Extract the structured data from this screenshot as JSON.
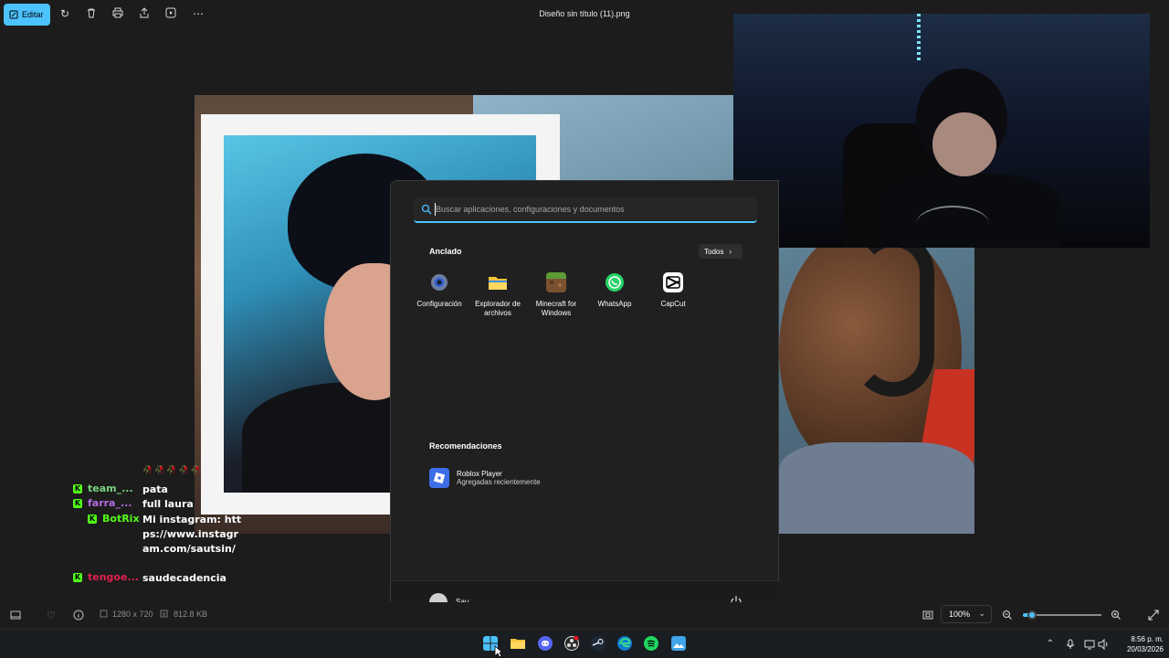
{
  "toolbar": {
    "edit_label": "Editar",
    "file_title": "Diseño sin título (11).png"
  },
  "chat": {
    "emotes": "🥀🥀🥀🥀🥀",
    "messages": [
      {
        "user": "team_...",
        "user_color": "#7ad37d",
        "text": "pata"
      },
      {
        "user": "farra_...",
        "user_color": "#b26be0",
        "text": "full laura"
      },
      {
        "user": "BotRix",
        "user_color": "#53fc18",
        "text": "Mi instagram: https://www.instagram.com/sautsin/"
      },
      {
        "user": "tengoe...",
        "user_color": "#e0204d",
        "text": "saudecadencia"
      }
    ]
  },
  "start_menu": {
    "search_placeholder": "Buscar aplicaciones, configuraciones y documentos",
    "pinned_title": "Anclado",
    "all_label": "Todos",
    "apps": [
      {
        "label": "Configuración",
        "icon": "settings-icon"
      },
      {
        "label": "Explorador de archivos",
        "icon": "file-explorer-icon"
      },
      {
        "label": "Minecraft for Windows",
        "icon": "minecraft-icon"
      },
      {
        "label": "WhatsApp",
        "icon": "whatsapp-icon"
      },
      {
        "label": "CapCut",
        "icon": "capcut-icon"
      }
    ],
    "recommendations_title": "Recomendaciones",
    "recommendation": {
      "title": "Roblox Player",
      "subtitle": "Agregadas recientemente"
    },
    "user_name": "Sau"
  },
  "status": {
    "dimensions": "1280 x 720",
    "file_size": "812.8 KB",
    "zoom": "100%",
    "zoom_level": 0.12
  },
  "taskbar": {
    "time": "8:56 p. m.",
    "date": "20/03/2026"
  },
  "colors": {
    "accent": "#4cc2ff",
    "kick_green": "#53fc18"
  }
}
